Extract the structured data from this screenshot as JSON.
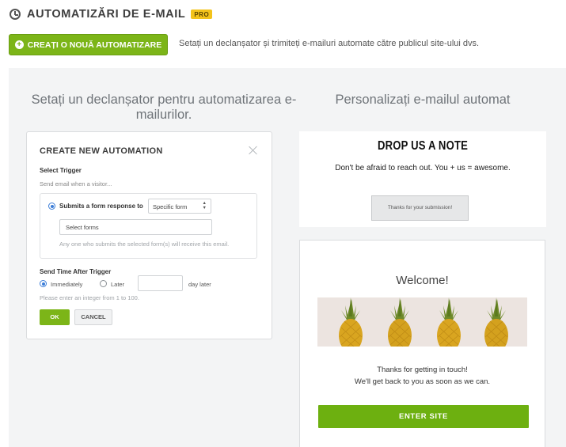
{
  "header": {
    "title": "AUTOMATIZĂRI DE E-MAIL",
    "badge": "PRO",
    "icon": "clock-icon"
  },
  "toolbar": {
    "create_label": "CREAȚI O NOUĂ AUTOMATIZARE",
    "description": "Setați un declanșator și trimiteți e-mailuri automate către publicul site-ului dvs."
  },
  "left_section": {
    "title": "Setați un declanșator pentru automatizarea e-mailurilor."
  },
  "right_section": {
    "title": "Personalizați e-mailul automat"
  },
  "automation_dialog": {
    "title": "CREATE NEW AUTOMATION",
    "select_trigger_label": "Select Trigger",
    "trigger_hint": "Send email when a visitor...",
    "trigger_option": "Submits a form response to",
    "trigger_option_selected": true,
    "form_select_value": "Specific form",
    "forms_input_value": "Select forms",
    "forms_help": "Any one who submits the selected form(s) will receive this email.",
    "send_time_label": "Send Time After Trigger",
    "immediately_label": "Immediately",
    "later_label": "Later",
    "selected_timing": "Immediately",
    "days_value": "",
    "days_suffix": "day later",
    "range_help": "Please enter an integer  from 1 to 100.",
    "ok_label": "OK",
    "cancel_label": "CANCEL"
  },
  "note_preview": {
    "title": "DROP US A NOTE",
    "subtitle": "Don't be afraid to reach out. You + us = awesome.",
    "button_label": "Thanks for your submission!"
  },
  "welcome_preview": {
    "title": "Welcome!",
    "message_line1": "Thanks for getting in touch!",
    "message_line2": "We'll get back to you as soon as we can.",
    "button_label": "ENTER SITE",
    "image": "pineapples-image"
  },
  "colors": {
    "accent_green": "#7cb518",
    "enter_green": "#6db010",
    "pro_badge": "#f3c31b",
    "panel_bg": "#f3f4f5",
    "radio_blue": "#3b7dd8"
  }
}
